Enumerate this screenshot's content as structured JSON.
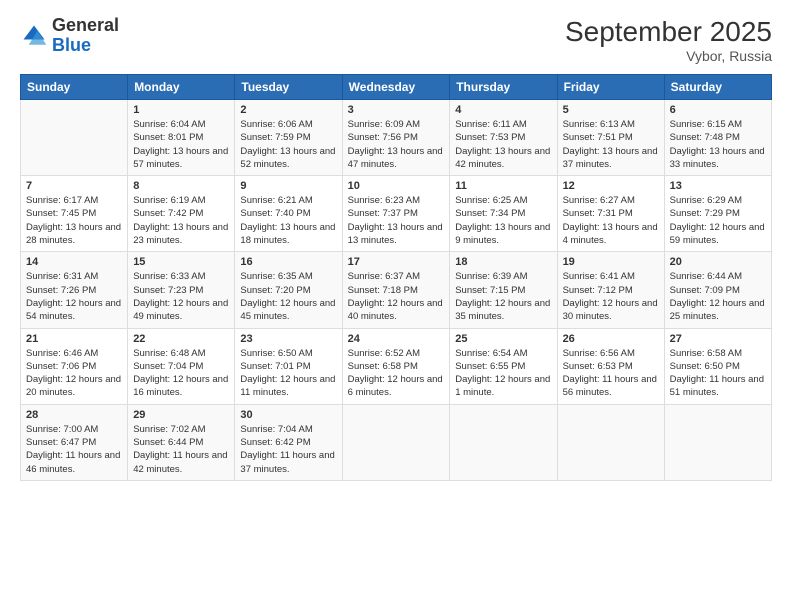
{
  "logo": {
    "general": "General",
    "blue": "Blue"
  },
  "title": "September 2025",
  "location": "Vybor, Russia",
  "days_of_week": [
    "Sunday",
    "Monday",
    "Tuesday",
    "Wednesday",
    "Thursday",
    "Friday",
    "Saturday"
  ],
  "weeks": [
    [
      {
        "day": "",
        "info": ""
      },
      {
        "day": "1",
        "info": "Sunrise: 6:04 AM\nSunset: 8:01 PM\nDaylight: 13 hours and 57 minutes."
      },
      {
        "day": "2",
        "info": "Sunrise: 6:06 AM\nSunset: 7:59 PM\nDaylight: 13 hours and 52 minutes."
      },
      {
        "day": "3",
        "info": "Sunrise: 6:09 AM\nSunset: 7:56 PM\nDaylight: 13 hours and 47 minutes."
      },
      {
        "day": "4",
        "info": "Sunrise: 6:11 AM\nSunset: 7:53 PM\nDaylight: 13 hours and 42 minutes."
      },
      {
        "day": "5",
        "info": "Sunrise: 6:13 AM\nSunset: 7:51 PM\nDaylight: 13 hours and 37 minutes."
      },
      {
        "day": "6",
        "info": "Sunrise: 6:15 AM\nSunset: 7:48 PM\nDaylight: 13 hours and 33 minutes."
      }
    ],
    [
      {
        "day": "7",
        "info": "Sunrise: 6:17 AM\nSunset: 7:45 PM\nDaylight: 13 hours and 28 minutes."
      },
      {
        "day": "8",
        "info": "Sunrise: 6:19 AM\nSunset: 7:42 PM\nDaylight: 13 hours and 23 minutes."
      },
      {
        "day": "9",
        "info": "Sunrise: 6:21 AM\nSunset: 7:40 PM\nDaylight: 13 hours and 18 minutes."
      },
      {
        "day": "10",
        "info": "Sunrise: 6:23 AM\nSunset: 7:37 PM\nDaylight: 13 hours and 13 minutes."
      },
      {
        "day": "11",
        "info": "Sunrise: 6:25 AM\nSunset: 7:34 PM\nDaylight: 13 hours and 9 minutes."
      },
      {
        "day": "12",
        "info": "Sunrise: 6:27 AM\nSunset: 7:31 PM\nDaylight: 13 hours and 4 minutes."
      },
      {
        "day": "13",
        "info": "Sunrise: 6:29 AM\nSunset: 7:29 PM\nDaylight: 12 hours and 59 minutes."
      }
    ],
    [
      {
        "day": "14",
        "info": "Sunrise: 6:31 AM\nSunset: 7:26 PM\nDaylight: 12 hours and 54 minutes."
      },
      {
        "day": "15",
        "info": "Sunrise: 6:33 AM\nSunset: 7:23 PM\nDaylight: 12 hours and 49 minutes."
      },
      {
        "day": "16",
        "info": "Sunrise: 6:35 AM\nSunset: 7:20 PM\nDaylight: 12 hours and 45 minutes."
      },
      {
        "day": "17",
        "info": "Sunrise: 6:37 AM\nSunset: 7:18 PM\nDaylight: 12 hours and 40 minutes."
      },
      {
        "day": "18",
        "info": "Sunrise: 6:39 AM\nSunset: 7:15 PM\nDaylight: 12 hours and 35 minutes."
      },
      {
        "day": "19",
        "info": "Sunrise: 6:41 AM\nSunset: 7:12 PM\nDaylight: 12 hours and 30 minutes."
      },
      {
        "day": "20",
        "info": "Sunrise: 6:44 AM\nSunset: 7:09 PM\nDaylight: 12 hours and 25 minutes."
      }
    ],
    [
      {
        "day": "21",
        "info": "Sunrise: 6:46 AM\nSunset: 7:06 PM\nDaylight: 12 hours and 20 minutes."
      },
      {
        "day": "22",
        "info": "Sunrise: 6:48 AM\nSunset: 7:04 PM\nDaylight: 12 hours and 16 minutes."
      },
      {
        "day": "23",
        "info": "Sunrise: 6:50 AM\nSunset: 7:01 PM\nDaylight: 12 hours and 11 minutes."
      },
      {
        "day": "24",
        "info": "Sunrise: 6:52 AM\nSunset: 6:58 PM\nDaylight: 12 hours and 6 minutes."
      },
      {
        "day": "25",
        "info": "Sunrise: 6:54 AM\nSunset: 6:55 PM\nDaylight: 12 hours and 1 minute."
      },
      {
        "day": "26",
        "info": "Sunrise: 6:56 AM\nSunset: 6:53 PM\nDaylight: 11 hours and 56 minutes."
      },
      {
        "day": "27",
        "info": "Sunrise: 6:58 AM\nSunset: 6:50 PM\nDaylight: 11 hours and 51 minutes."
      }
    ],
    [
      {
        "day": "28",
        "info": "Sunrise: 7:00 AM\nSunset: 6:47 PM\nDaylight: 11 hours and 46 minutes."
      },
      {
        "day": "29",
        "info": "Sunrise: 7:02 AM\nSunset: 6:44 PM\nDaylight: 11 hours and 42 minutes."
      },
      {
        "day": "30",
        "info": "Sunrise: 7:04 AM\nSunset: 6:42 PM\nDaylight: 11 hours and 37 minutes."
      },
      {
        "day": "",
        "info": ""
      },
      {
        "day": "",
        "info": ""
      },
      {
        "day": "",
        "info": ""
      },
      {
        "day": "",
        "info": ""
      }
    ]
  ]
}
